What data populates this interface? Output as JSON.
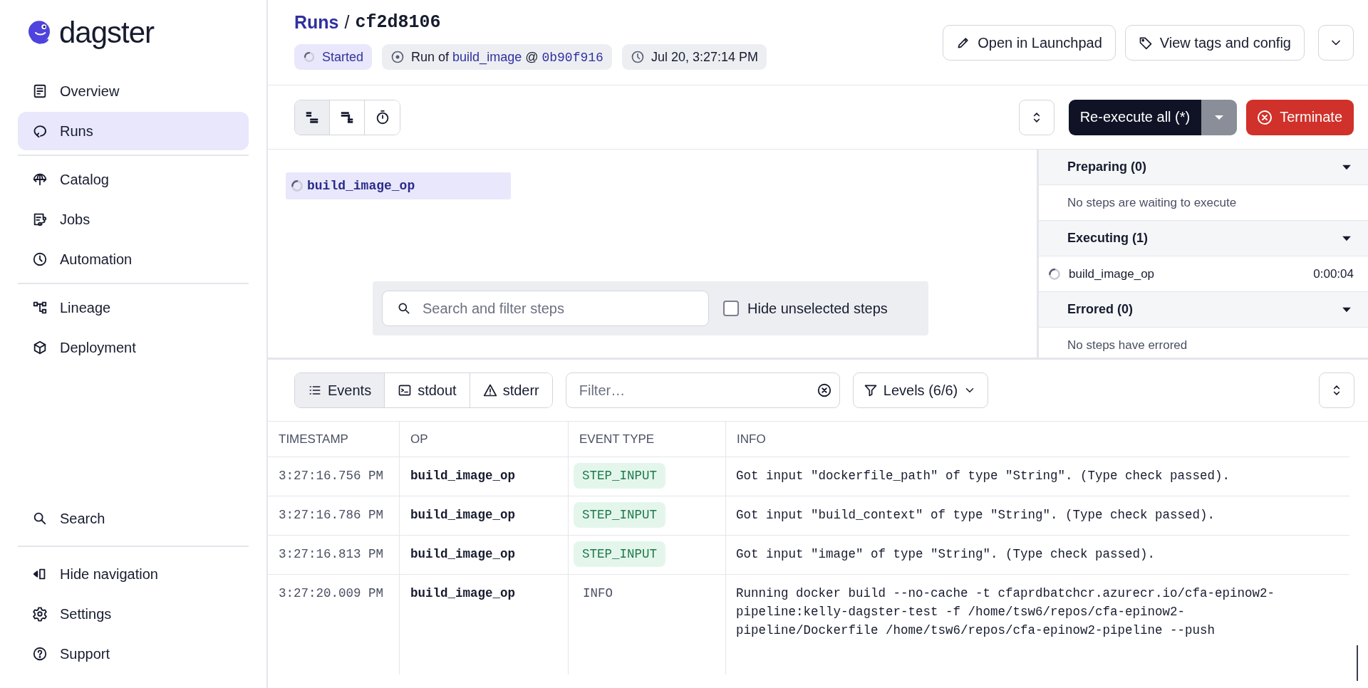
{
  "logo": {
    "text": "dagster"
  },
  "nav_groups": [
    {
      "items": [
        {
          "label": "Overview",
          "selected": false
        },
        {
          "label": "Runs",
          "selected": true
        }
      ]
    },
    {
      "items": [
        {
          "label": "Catalog",
          "selected": false
        },
        {
          "label": "Jobs",
          "selected": false
        },
        {
          "label": "Automation",
          "selected": false
        }
      ]
    },
    {
      "items": [
        {
          "label": "Lineage",
          "selected": false
        },
        {
          "label": "Deployment",
          "selected": false
        }
      ]
    }
  ],
  "bottom_nav_groups": [
    {
      "items": [
        {
          "label": "Search"
        }
      ]
    },
    {
      "items": [
        {
          "label": "Hide navigation"
        },
        {
          "label": "Settings"
        },
        {
          "label": "Support"
        }
      ]
    }
  ],
  "header": {
    "breadcrumb": {
      "parent": "Runs",
      "separator": "/",
      "current": "cf2d8106"
    },
    "tags": [
      {
        "kind": "status",
        "text": "Started"
      },
      {
        "kind": "run_of",
        "prefix": "Run of",
        "job": "build_image",
        "at": "@",
        "snapshot": "0b90f916"
      },
      {
        "kind": "time",
        "text": "Jul 20, 3:27:14 PM"
      }
    ],
    "actions": [
      {
        "label": "Open in Launchpad"
      },
      {
        "label": "View tags and config"
      }
    ]
  },
  "toolbar": {
    "view_modes": [
      {
        "selected": true
      },
      {
        "selected": false
      },
      {
        "selected": false
      }
    ],
    "reexecute": "Re-execute all (*)",
    "terminate": "Terminate"
  },
  "graph": {
    "steps": [
      {
        "label": "build_image_op"
      }
    ],
    "search": {
      "placeholder": "Search and filter steps"
    },
    "hide_unselected": {
      "label": "Hide unselected steps",
      "checked": false
    }
  },
  "step_panel": {
    "sections": [
      {
        "title": "Preparing (0)",
        "expanded": true,
        "empty": "No steps are waiting to execute"
      },
      {
        "title": "Executing (1)",
        "expanded": true,
        "steps": [
          {
            "name": "build_image_op",
            "elapsed": "0:00:04"
          }
        ]
      },
      {
        "title": "Errored (0)",
        "expanded": true,
        "empty": "No steps have errored"
      }
    ]
  },
  "logs": {
    "tabs": [
      {
        "label": "Events",
        "selected": true
      },
      {
        "label": "stdout",
        "selected": false
      },
      {
        "label": "stderr",
        "selected": false
      }
    ],
    "filter": {
      "placeholder": "Filter…"
    },
    "levels": "Levels (6/6)",
    "table": {
      "columns": [
        "TIMESTAMP",
        "OP",
        "EVENT TYPE",
        "INFO"
      ],
      "rows": [
        {
          "timestamp": "3:27:16.756 PM",
          "op": "build_image_op",
          "event_type": "STEP_INPUT",
          "kind": "badge",
          "info": "Got input \"dockerfile_path\" of type \"String\". (Type check passed)."
        },
        {
          "timestamp": "3:27:16.786 PM",
          "op": "build_image_op",
          "event_type": "STEP_INPUT",
          "kind": "badge",
          "info": "Got input \"build_context\" of type \"String\". (Type check passed)."
        },
        {
          "timestamp": "3:27:16.813 PM",
          "op": "build_image_op",
          "event_type": "STEP_INPUT",
          "kind": "badge",
          "info": "Got input \"image\" of type \"String\". (Type check passed)."
        },
        {
          "timestamp": "3:27:20.009 PM",
          "op": "build_image_op",
          "event_type": "INFO",
          "kind": "plain",
          "info": "Running docker build --no-cache -t cfaprdbatchcr.azurecr.io/cfa-epinow2-pipeline:kelly-dagster-test -f /home/tsw6/repos/cfa-epinow2-pipeline/Dockerfile /home/tsw6/repos/cfa-epinow2-pipeline --push"
        }
      ]
    }
  }
}
